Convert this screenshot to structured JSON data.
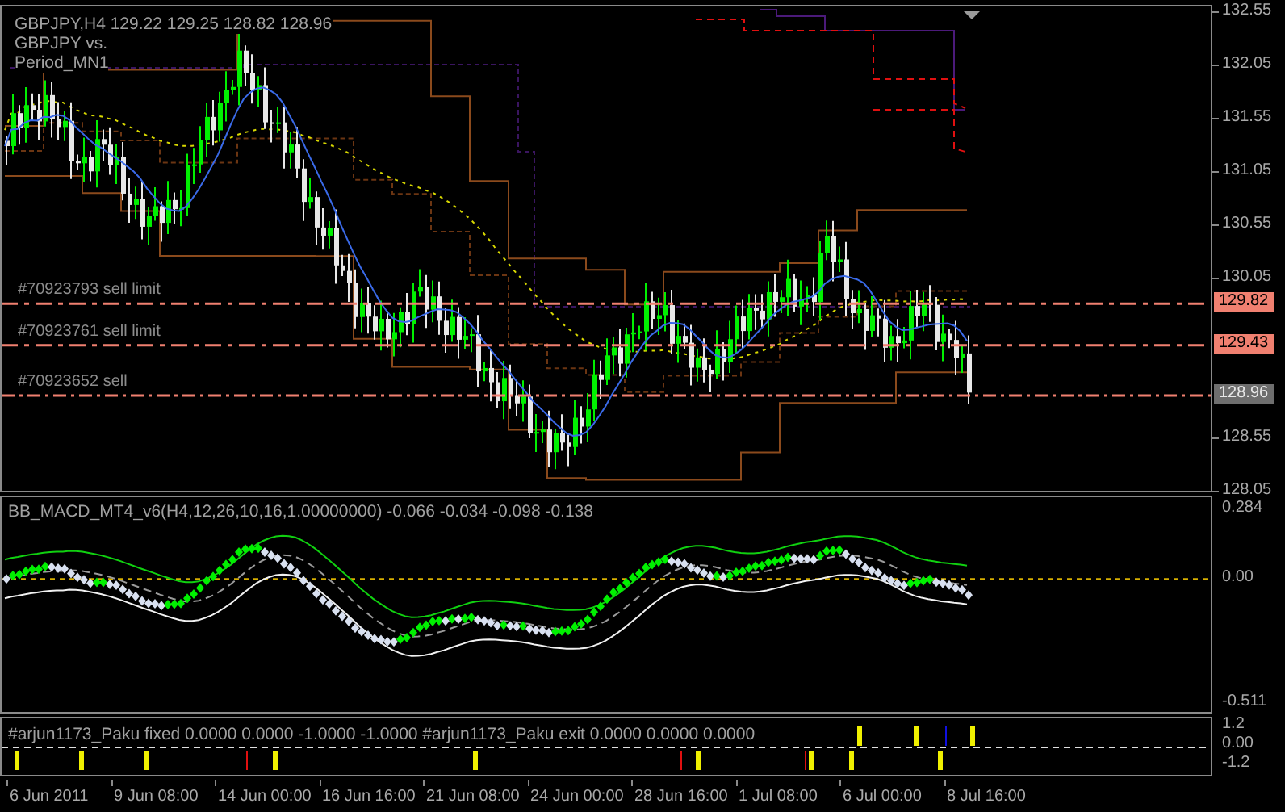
{
  "symbol_label": "GBPJPY,H4  129.22 129.25 128.82 128.96",
  "overlay_labels": [
    "GBPJPY vs.",
    "Period_MN1"
  ],
  "price_axis_upper": [
    "132.55",
    "132.05",
    "131.55",
    "131.05",
    "130.55",
    "130.05"
  ],
  "price_axis_lower": [
    "128.55",
    "128.05"
  ],
  "orders": [
    {
      "label": "#70923793 sell limit",
      "price_tag": "129.82",
      "kind": "pending"
    },
    {
      "label": "#70923761 sell limit",
      "price_tag": "129.43",
      "kind": "pending"
    },
    {
      "label": "#70923652 sell",
      "price_tag": "128.96",
      "kind": "open"
    }
  ],
  "macd": {
    "label": "BB_MACD_MT4_v6(H4,12,26,10,16,1.00000000) -0.066 -0.034 -0.098 -0.138",
    "axis": [
      "0.284",
      "0.00",
      "-0.511"
    ]
  },
  "signal": {
    "label": "#arjun1173_Paku fixed 0.0000 0.0000 -1.0000 -1.0000 #arjun1173_Paku exit 0.0000 0.0000 0.0000",
    "axis": [
      "1.2",
      "0.00",
      "-1.2"
    ]
  },
  "time_axis": [
    "6 Jun 2011",
    "9 Jun 08:00",
    "14 Jun 00:00",
    "16 Jun 16:00",
    "21 Jun 08:00",
    "24 Jun 00:00",
    "28 Jun 16:00",
    "1 Jul 08:00",
    "6 Jul 00:00",
    "8 Jul 16:00"
  ]
}
